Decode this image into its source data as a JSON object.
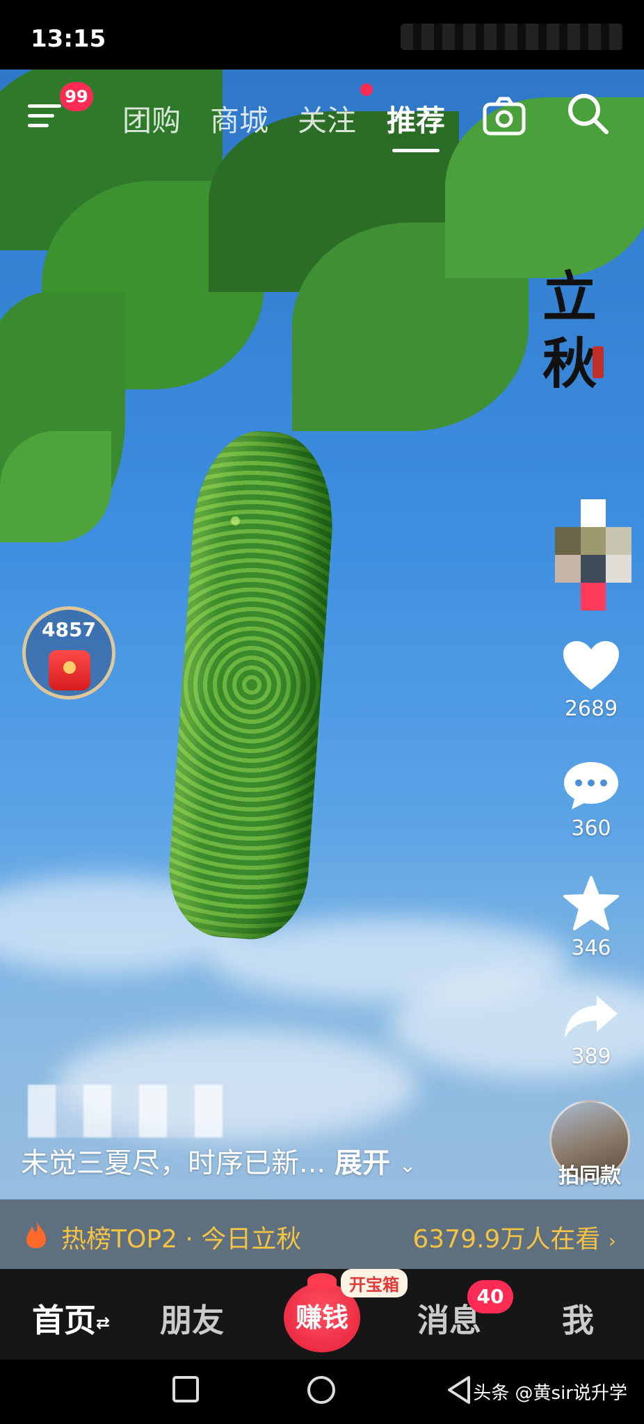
{
  "status_bar": {
    "time": "13:15"
  },
  "top_nav": {
    "menu_badge": "99",
    "tabs": [
      {
        "label": "团购",
        "active": false
      },
      {
        "label": "商城",
        "active": false
      },
      {
        "label": "关注",
        "active": false,
        "dot": true
      },
      {
        "label": "推荐",
        "active": true
      }
    ],
    "icons": [
      "menu-icon",
      "camera-icon",
      "search-icon"
    ]
  },
  "video": {
    "overlay_text": "立秋",
    "caption": "未觉三夏尽，时序已新...",
    "expand_label": "展开",
    "same_style_label": "拍同款"
  },
  "red_packet": {
    "count": "4857"
  },
  "actions": {
    "likes": "2689",
    "comments": "360",
    "favorites": "346",
    "shares": "389"
  },
  "hot_bar": {
    "left": "热榜TOP2 · 今日立秋",
    "right": "6379.9万人在看"
  },
  "bottom_tabs": {
    "home": "首页",
    "friends": "朋友",
    "earn": "赚钱",
    "treasure": "开宝箱",
    "messages": "消息",
    "messages_badge": "40",
    "me": "我"
  },
  "watermark": "头条 @黄sir说升学",
  "colors": {
    "accent": "#fe2c55",
    "hot": "#f6c342"
  }
}
